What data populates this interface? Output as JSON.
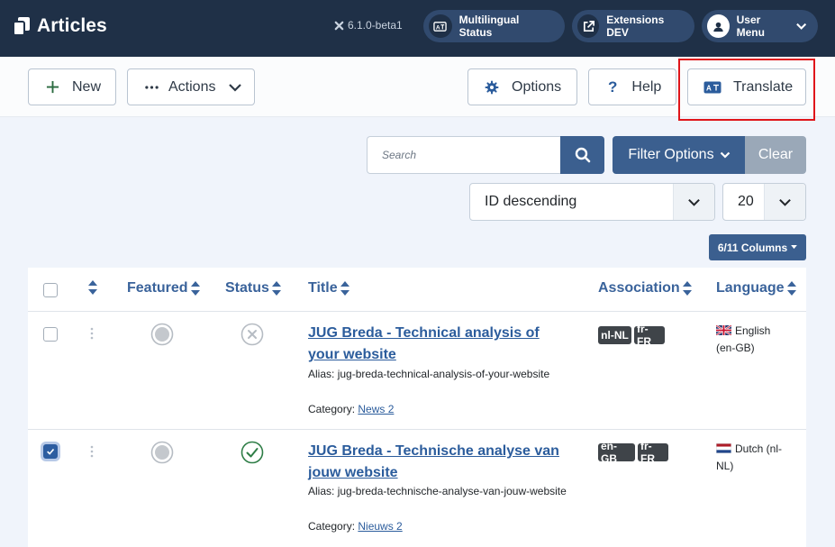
{
  "header": {
    "title": "Articles",
    "version": "6.1.0-beta1",
    "pills": [
      {
        "label": "Multilingual Status",
        "icon": "language-icon"
      },
      {
        "label": "Extensions DEV",
        "icon": "external-link-icon"
      },
      {
        "label": "User Menu",
        "icon": "user-icon"
      }
    ]
  },
  "toolbar": {
    "new_label": "New",
    "actions_label": "Actions",
    "options_label": "Options",
    "help_label": "Help",
    "translate_label": "Translate"
  },
  "filters": {
    "search_placeholder": "Search",
    "filter_options_label": "Filter Options",
    "clear_label": "Clear",
    "ordering_value": "ID descending",
    "limit_value": "20",
    "columns_label": "6/11 Columns"
  },
  "table": {
    "headers": {
      "featured": "Featured",
      "status": "Status",
      "title": "Title",
      "association": "Association",
      "language": "Language"
    },
    "rows": [
      {
        "checked": false,
        "title": "JUG Breda - Technical analysis of your website",
        "alias_label": "Alias:",
        "alias": "jug-breda-technical-analysis-of-your-website",
        "category_label": "Category:",
        "category": "News 2",
        "status": "unpublished",
        "associations": [
          "nl-NL",
          "fr-FR"
        ],
        "language": "English (en-GB)"
      },
      {
        "checked": true,
        "title": "JUG Breda - Technische analyse van jouw website",
        "alias_label": "Alias:",
        "alias": "jug-breda-technische-analyse-van-jouw-website",
        "category_label": "Category:",
        "category": "Nieuws 2",
        "status": "published",
        "associations": [
          "en-GB",
          "fr-FR"
        ],
        "language": "Dutch (nl-NL)"
      }
    ]
  },
  "colors": {
    "header_bg": "#1f3047",
    "primary": "#3b5f8f",
    "link": "#2b5c9c",
    "highlight": "#e0151a"
  }
}
